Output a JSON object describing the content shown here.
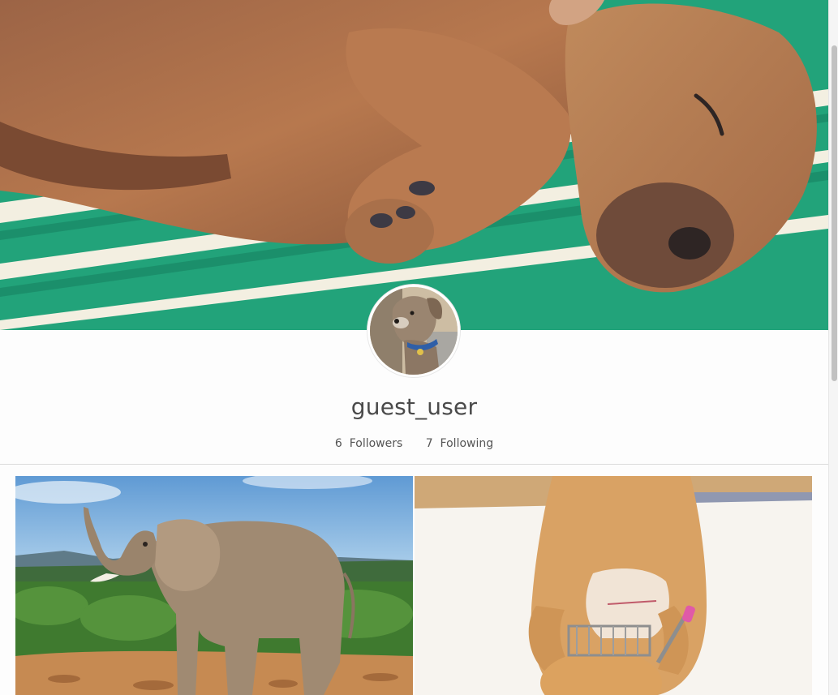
{
  "profile": {
    "username": "guest_user",
    "followers_count": "6",
    "followers_label": "Followers",
    "following_count": "7",
    "following_label": "Following"
  },
  "images": {
    "cover": "sleeping-puppy-on-striped-towel",
    "avatar": "dog-with-collar",
    "grid": [
      "elephant-raising-trunk",
      "cat-with-toy-shopping-cart"
    ]
  },
  "colors": {
    "towel_green": "#1fa176",
    "towel_stripe": "#f4f1e6",
    "puppy_fur": "#b4734a",
    "text": "#4a4a4a",
    "sky": "#6ea6d8"
  }
}
